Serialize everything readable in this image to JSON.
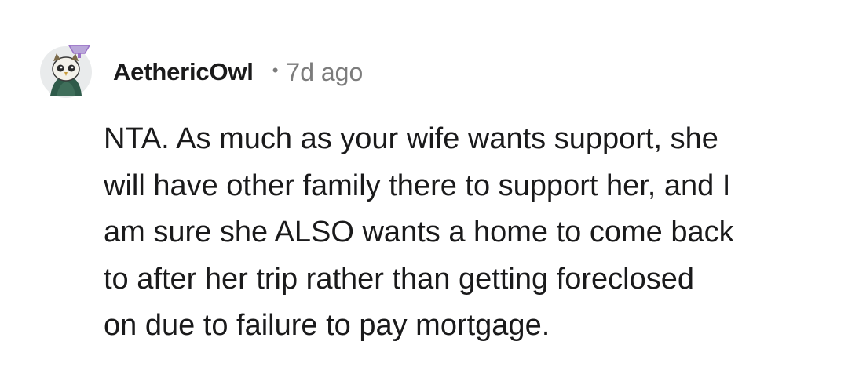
{
  "comment": {
    "author": "AethericOwl",
    "separator": "•",
    "time_ago": "7d ago",
    "avatar_icon": "owl-avatar-icon",
    "body_lines": [
      "NTA. As much as your wife wants support, she",
      "will have other family there to support her, and I",
      "am sure she ALSO wants a home to come back",
      "to after her trip rather than getting foreclosed",
      "on due to failure to pay mortgage."
    ]
  },
  "colors": {
    "text": "#1a1a1b",
    "meta": "#7c7c7c",
    "avatar_bg": "#e9ebec",
    "avatar_accent": "#2f5b4a",
    "avatar_hat": "#9a72c8"
  }
}
